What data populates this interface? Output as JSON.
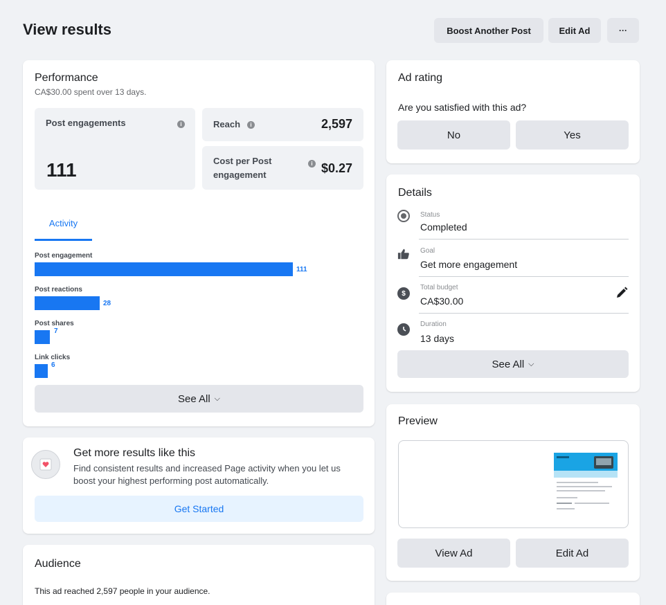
{
  "header": {
    "title": "View results",
    "boost_label": "Boost Another Post",
    "edit_label": "Edit Ad",
    "more_label": "···"
  },
  "performance": {
    "title": "Performance",
    "subtitle": "CA$30.00 spent over 13 days.",
    "post_engagements_label": "Post engagements",
    "post_engagements_value": "111",
    "reach_label": "Reach",
    "reach_value": "2,597",
    "cost_label_line1": "Cost per Post",
    "cost_label_line2": "engagement",
    "cost_value": "$0.27",
    "tab_label": "Activity",
    "see_all_label": "See All",
    "activity": [
      {
        "label": "Post engagement",
        "value": 111
      },
      {
        "label": "Post reactions",
        "value": 28
      },
      {
        "label": "Post shares",
        "value": 7
      },
      {
        "label": "Link clicks",
        "value": 6
      }
    ]
  },
  "get_more": {
    "title": "Get more results like this",
    "description": "Find consistent results and increased Page activity when you let us boost your highest performing post automatically.",
    "button_label": "Get Started"
  },
  "audience": {
    "title": "Audience",
    "text": "This ad reached 2,597 people in your audience."
  },
  "ad_rating": {
    "title": "Ad rating",
    "question": "Are you satisfied with this ad?",
    "no_label": "No",
    "yes_label": "Yes"
  },
  "details": {
    "title": "Details",
    "status_label": "Status",
    "status_value": "Completed",
    "goal_label": "Goal",
    "goal_value": "Get more engagement",
    "budget_label": "Total budget",
    "budget_value": "CA$30.00",
    "duration_label": "Duration",
    "duration_value": "13 days",
    "see_all_label": "See All"
  },
  "preview": {
    "title": "Preview",
    "view_label": "View Ad",
    "edit_label": "Edit Ad"
  },
  "colors": {
    "accent": "#1877f2",
    "background": "#f0f2f5",
    "button_gray": "#e4e6eb"
  }
}
